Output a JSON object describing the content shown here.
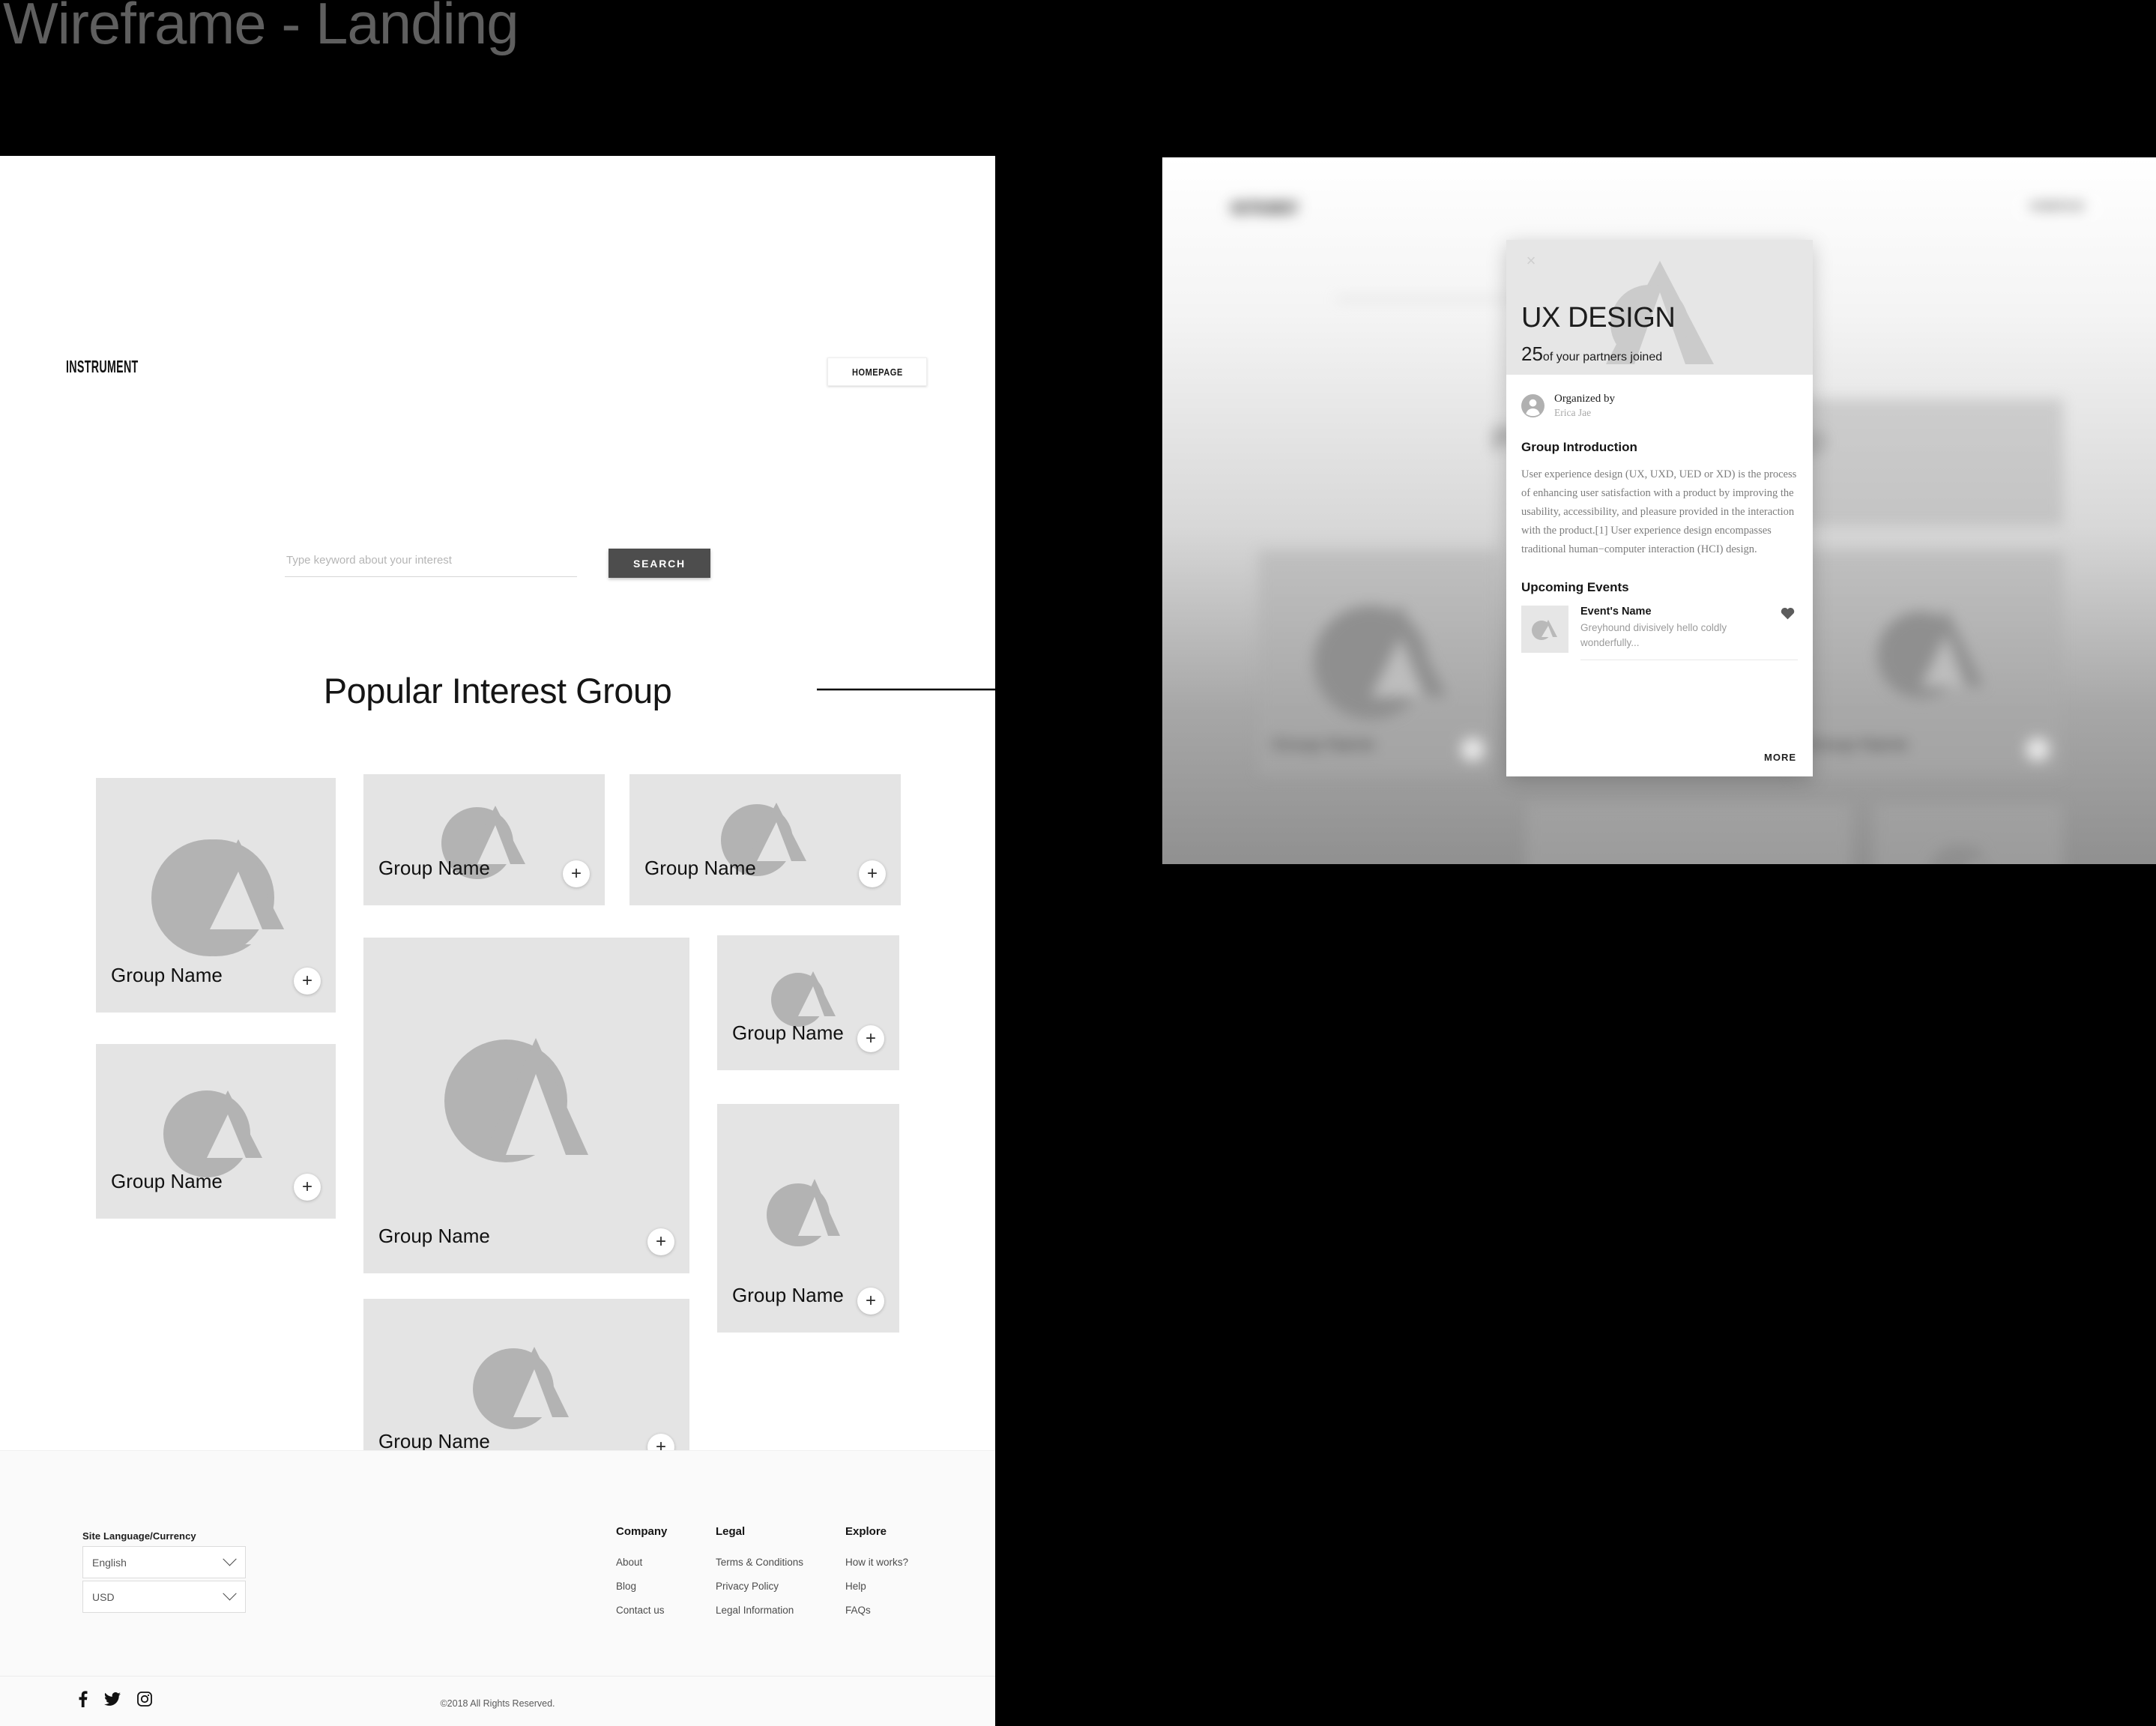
{
  "board": {
    "title": "Wireframe - Landing"
  },
  "colors": {
    "page_bg": "#ffffff",
    "canvas_bg": "#000000",
    "card_bg": "#e4e4e4",
    "shape_gray": "#b3b3b3",
    "search_button": "#4d4d4d",
    "footer_bg": "#fafafa",
    "title_gray": "#5f5f5f"
  },
  "header": {
    "logo": "INSTRUMENT",
    "homepage_label": "HOMEPAGE"
  },
  "search": {
    "placeholder": "Type keyword about your interest",
    "value": "",
    "button_label": "SEARCH"
  },
  "main": {
    "section_title": "Popular Interest Group",
    "cards": [
      {
        "label": "Group Name",
        "plus": "+"
      },
      {
        "label": "Group Name",
        "plus": "+"
      },
      {
        "label": "Group Name",
        "plus": "+"
      },
      {
        "label": "Group Name",
        "plus": "+"
      },
      {
        "label": "Group Name",
        "plus": "+"
      },
      {
        "label": "Group Name",
        "plus": "+"
      },
      {
        "label": "Group Name",
        "plus": "+"
      },
      {
        "label": "Group Name",
        "plus": "+"
      }
    ]
  },
  "footer": {
    "lang_currency_label": "Site Language/Currency",
    "language_selected": "English",
    "currency_selected": "USD",
    "columns": [
      {
        "heading": "Company",
        "links": [
          "About",
          "Blog",
          "Contact us"
        ]
      },
      {
        "heading": "Legal",
        "links": [
          "Terms & Conditions",
          "Privacy Policy",
          "Legal Information"
        ]
      },
      {
        "heading": "Explore",
        "links": [
          "How it works?",
          "Help",
          "FAQs"
        ]
      }
    ],
    "socials": [
      "facebook-icon",
      "twitter-icon",
      "instagram-icon"
    ],
    "copyright": "©2018 All Rights Reserved."
  },
  "modal": {
    "close_glyph": "×",
    "title": "UX DESIGN",
    "joined_count": "25",
    "joined_suffix": "of your partners joined",
    "organized_by_label": "Organized by",
    "organizer_name": "Erica Jae",
    "intro_heading": "Group Introduction",
    "intro_body": "User experience design (UX, UXD, UED or XD) is the process of enhancing user satisfaction with a product by improving the usability, accessibility, and pleasure provided in the interaction with the product.[1] User experience design encompasses traditional human−computer interaction (HCI) design.",
    "events_heading": "Upcoming Events",
    "event": {
      "title": "Event's Name",
      "description": "Greyhound divisively hello coldly wonderfully...",
      "favorite_icon": "heart-icon"
    },
    "more_label": "MORE"
  },
  "blurred_page": {
    "logo": "INSTRUMENT",
    "homepage_label": "HOMEPAGE",
    "section_title": "Popular Interest Group",
    "card_label": "Group Name"
  }
}
